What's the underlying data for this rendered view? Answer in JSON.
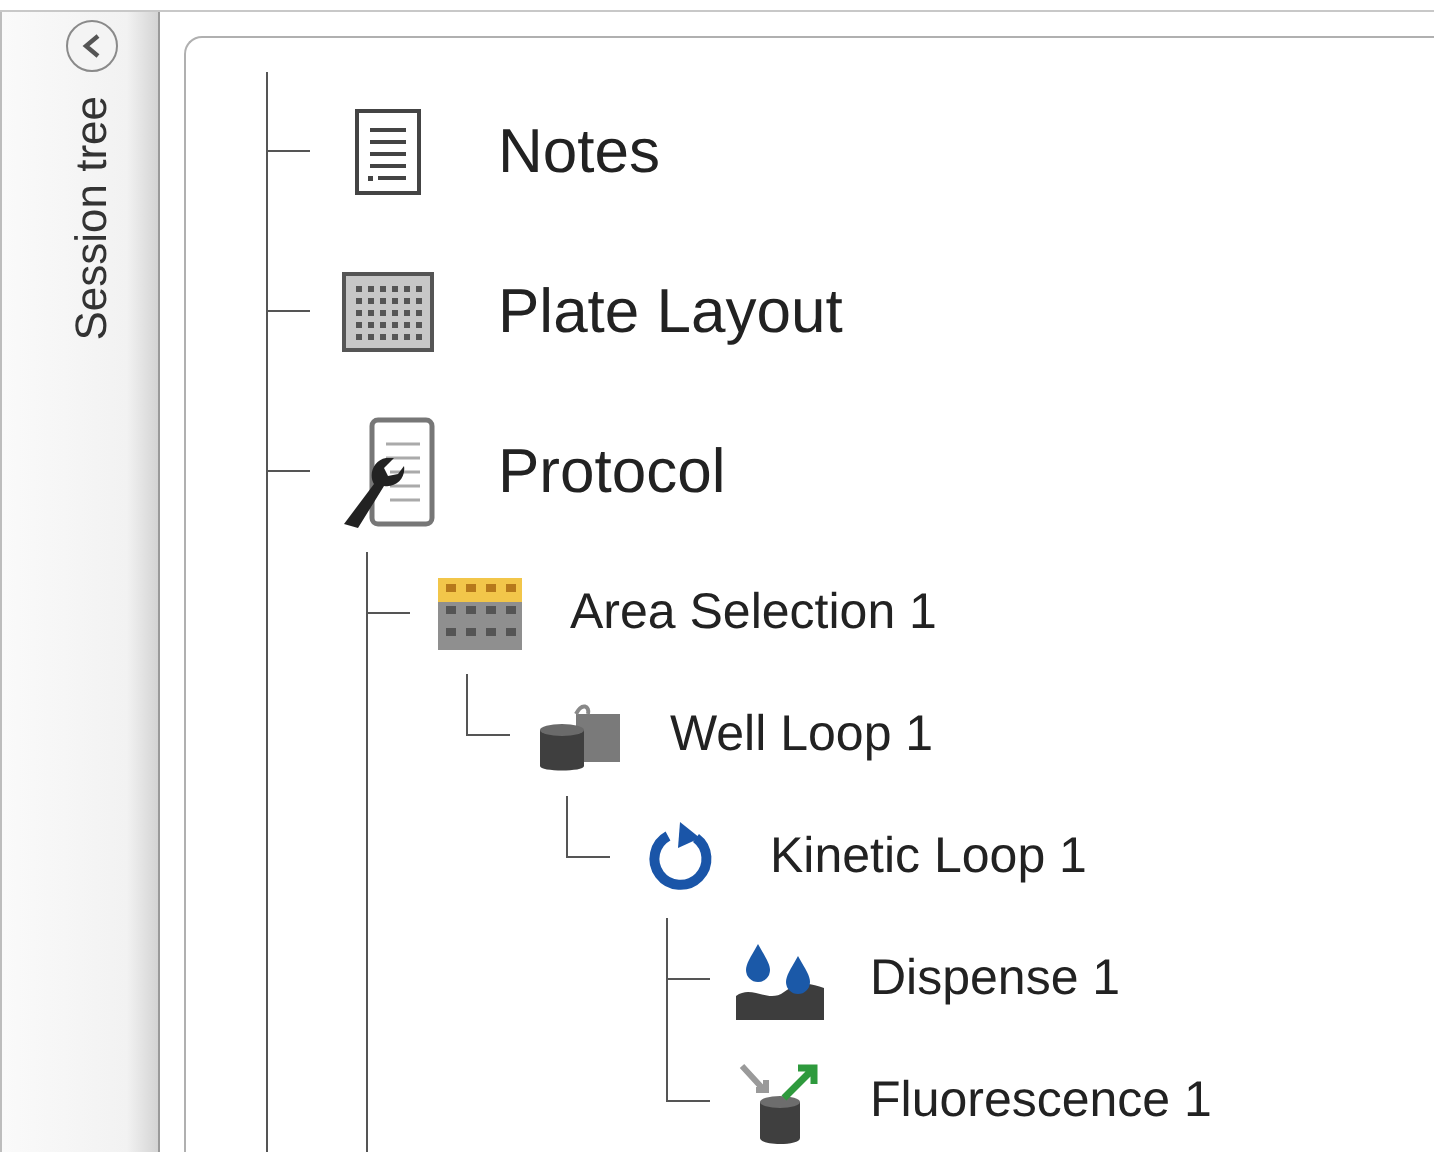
{
  "sidebar": {
    "title": "Session tree"
  },
  "tree": {
    "more_below": true,
    "items": [
      {
        "label": "Notes",
        "kind": "notes"
      },
      {
        "label": "Plate Layout",
        "kind": "plate"
      },
      {
        "label": "Protocol",
        "kind": "protocol",
        "more_below": true,
        "children": [
          {
            "label": "Area Selection 1",
            "kind": "area",
            "children": [
              {
                "label": "Well Loop 1",
                "kind": "wellloop",
                "children": [
                  {
                    "label": "Kinetic Loop 1",
                    "kind": "kinetic",
                    "children": [
                      {
                        "label": "Dispense 1",
                        "kind": "dispense"
                      },
                      {
                        "label": "Fluorescence 1",
                        "kind": "fluorescence"
                      }
                    ]
                  }
                ]
              }
            ]
          }
        ]
      }
    ]
  }
}
